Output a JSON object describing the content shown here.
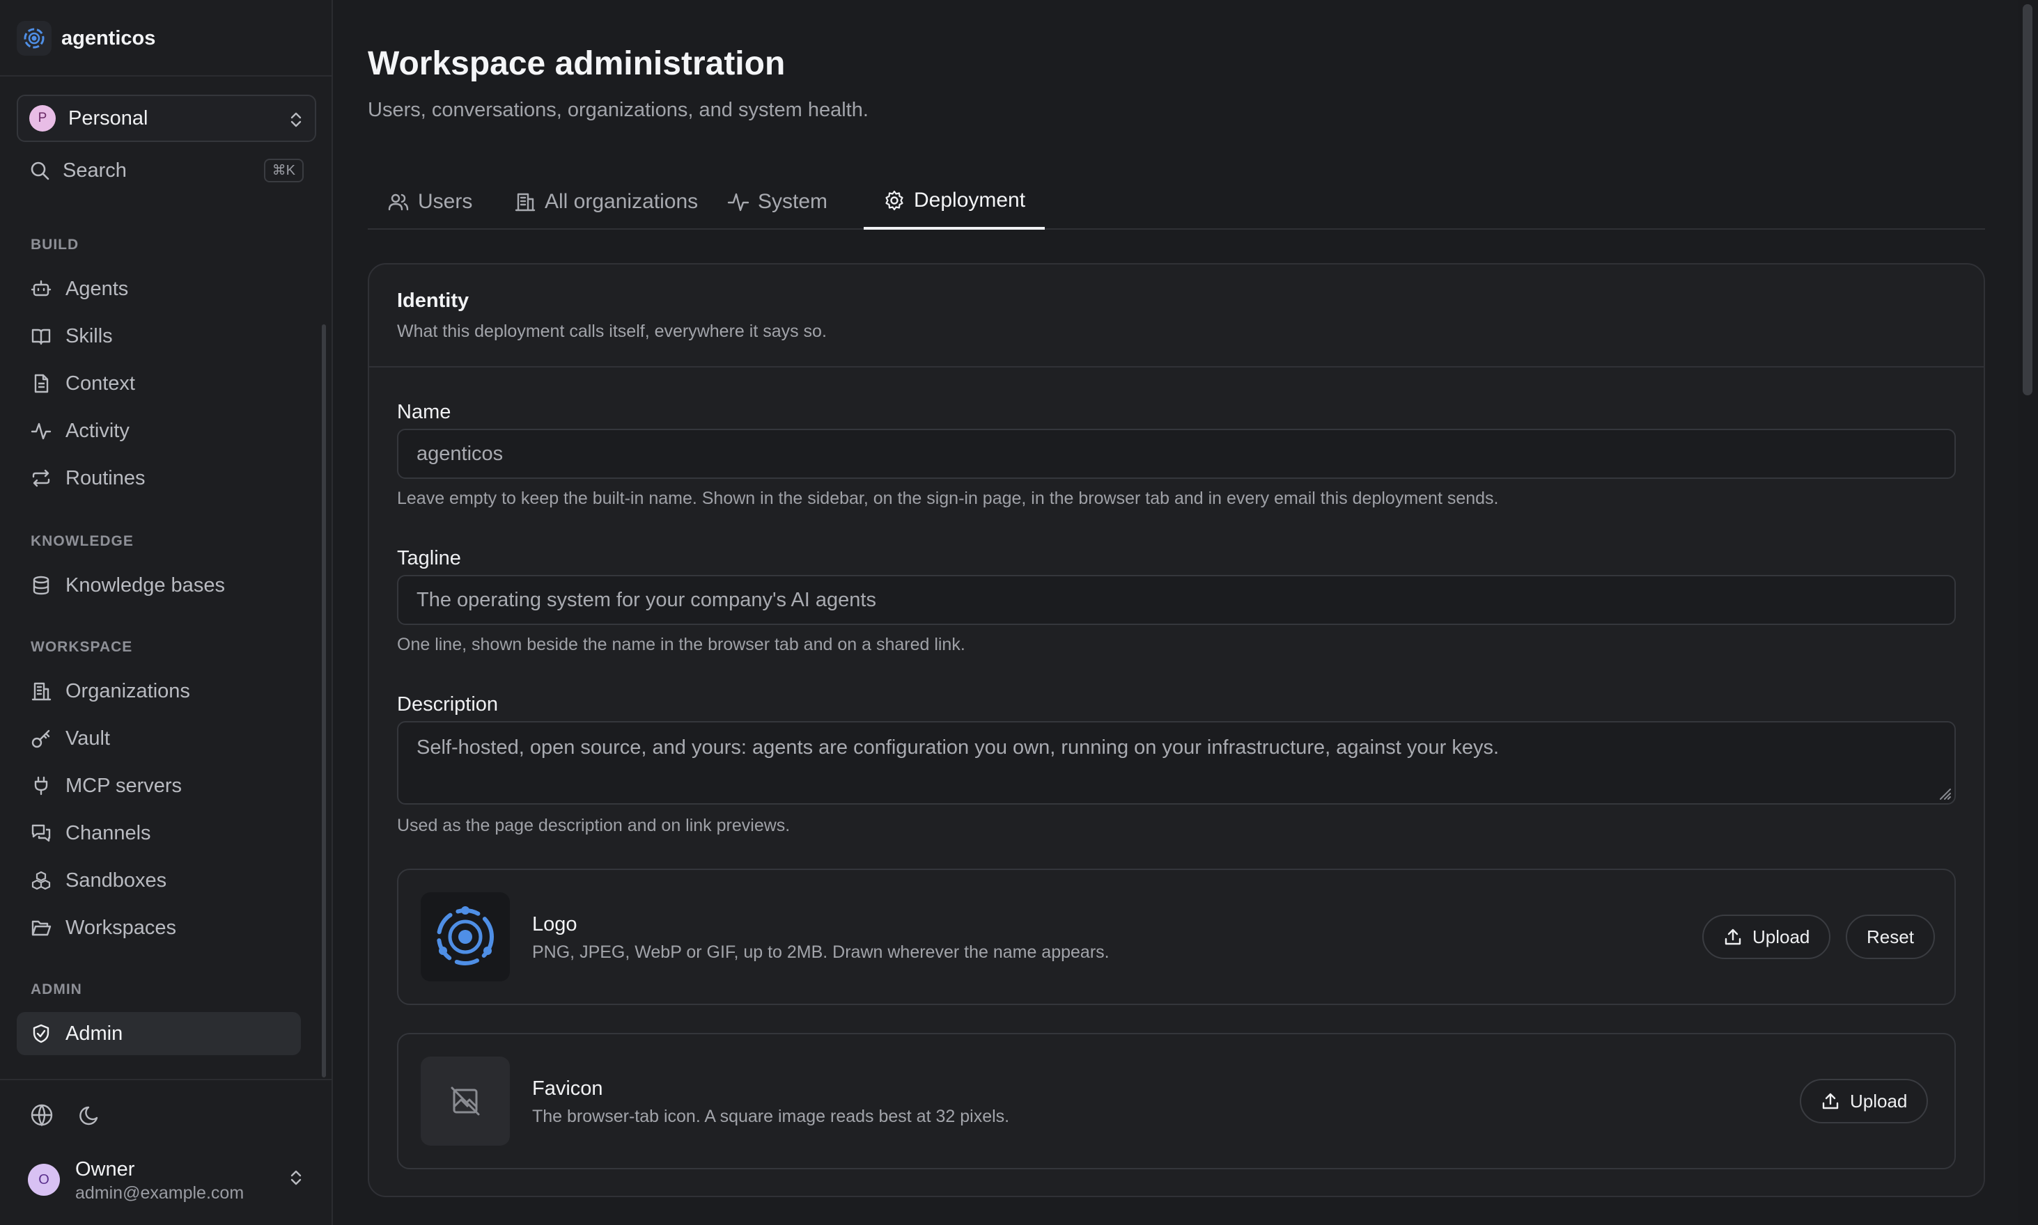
{
  "app": {
    "name": "agenticos"
  },
  "sidebar": {
    "workspace": {
      "avatar_letter": "P",
      "name": "Personal"
    },
    "search": {
      "label": "Search",
      "shortcut": "⌘K"
    },
    "sections": {
      "build": {
        "label": "BUILD",
        "items": [
          "Agents",
          "Skills",
          "Context",
          "Activity",
          "Routines"
        ]
      },
      "knowledge": {
        "label": "KNOWLEDGE",
        "items": [
          "Knowledge bases"
        ]
      },
      "workspace": {
        "label": "WORKSPACE",
        "items": [
          "Organizations",
          "Vault",
          "MCP servers",
          "Channels",
          "Sandboxes",
          "Workspaces"
        ]
      },
      "admin": {
        "label": "ADMIN",
        "items": [
          "Admin"
        ]
      }
    },
    "user": {
      "avatar_letter": "O",
      "name": "Owner",
      "email": "admin@example.com"
    }
  },
  "header": {
    "title": "Workspace administration",
    "subtitle": "Users, conversations, organizations, and system health."
  },
  "tabs": [
    "Users",
    "All organizations",
    "System",
    "Deployment"
  ],
  "active_tab": "Deployment",
  "identity": {
    "title": "Identity",
    "description": "What this deployment calls itself, everywhere it says so.",
    "name": {
      "label": "Name",
      "value": "agenticos",
      "help": "Leave empty to keep the built-in name. Shown in the sidebar, on the sign-in page, in the browser tab and in every email this deployment sends."
    },
    "tagline": {
      "label": "Tagline",
      "value": "The operating system for your company's AI agents",
      "help": "One line, shown beside the name in the browser tab and on a shared link."
    },
    "description_field": {
      "label": "Description",
      "value": "Self-hosted, open source, and yours: agents are configuration you own, running on your infrastructure, against your keys.",
      "help": "Used as the page description and on link previews."
    },
    "logo": {
      "title": "Logo",
      "description": "PNG, JPEG, WebP or GIF, up to 2MB. Drawn wherever the name appears.",
      "upload_label": "Upload",
      "reset_label": "Reset"
    },
    "favicon": {
      "title": "Favicon",
      "description": "The browser-tab icon. A square image reads best at 32 pixels.",
      "upload_label": "Upload"
    }
  },
  "colors": {
    "accent": "#4f8fe6",
    "background": "#1b1c1f",
    "sidebar": "#1d1e21"
  }
}
